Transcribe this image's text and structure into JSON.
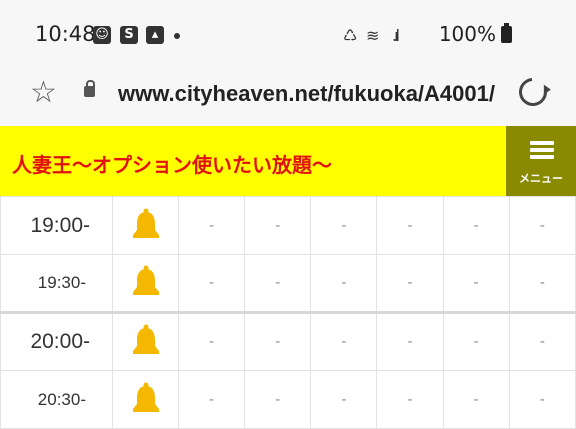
{
  "status_bar": {
    "time": "10:48",
    "left_icons": [
      "emoji-face-icon",
      "s-app-icon",
      "gallery-icon",
      "notification-dot-icon"
    ],
    "battery": "100%",
    "right_icons": [
      "battery-saver-icon",
      "wifi-icon",
      "signal-icon",
      "battery-icon"
    ]
  },
  "browser": {
    "url": "www.cityheaven.net/fukuoka/A4001/",
    "star_icon": "star-outline-icon",
    "lock_icon": "lock-icon",
    "reload_icon": "reload-icon"
  },
  "site": {
    "title": "人妻王〜オプション使いたい放題〜",
    "header_bg": "#ffff00",
    "title_color": "#e21010",
    "menu_label": "メニュー",
    "menu_bg": "#8a8a00"
  },
  "schedule": {
    "dash": "-",
    "bell_color": "#f5b800",
    "rows": [
      {
        "time": "19:00-"
      },
      {
        "time": "19:30-"
      },
      {
        "time": "20:00-"
      },
      {
        "time": "20:30-"
      }
    ]
  }
}
